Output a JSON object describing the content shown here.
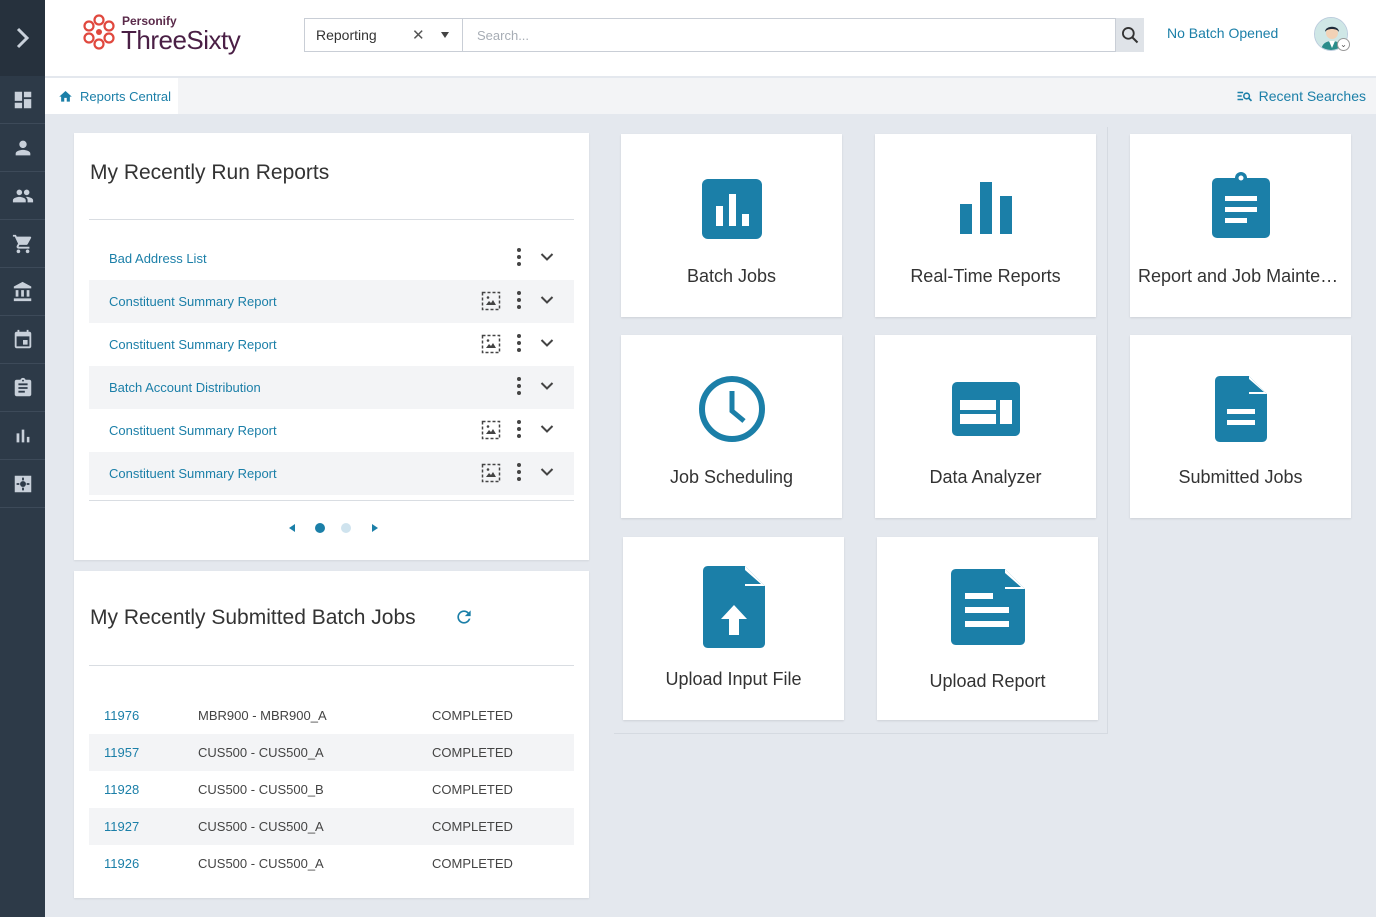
{
  "colors": {
    "accent": "#1b7fa8",
    "rail": "#2d3a48",
    "tile_icon": "#1b7fa8"
  },
  "header": {
    "brand_top": "Personify",
    "brand_main": "ThreeSixty",
    "module_value": "Reporting",
    "search_placeholder": "Search...",
    "batch_status": "No Batch Opened"
  },
  "subnav": {
    "breadcrumb": "Reports Central",
    "recent_searches": "Recent Searches"
  },
  "recent_reports": {
    "title": "My Recently Run Reports",
    "items": [
      {
        "label": "Bad Address List",
        "has_preview": false
      },
      {
        "label": "Constituent Summary Report",
        "has_preview": true
      },
      {
        "label": "Constituent Summary Report",
        "has_preview": true
      },
      {
        "label": "Batch Account Distribution",
        "has_preview": false
      },
      {
        "label": "Constituent Summary Report",
        "has_preview": true
      },
      {
        "label": "Constituent Summary Report",
        "has_preview": true
      }
    ],
    "pager": {
      "current": 1,
      "total": 2
    }
  },
  "batch_jobs": {
    "title": "My Recently Submitted Batch Jobs",
    "rows": [
      {
        "id": "11976",
        "name": "MBR900 - MBR900_A",
        "status": "COMPLETED"
      },
      {
        "id": "11957",
        "name": "CUS500 - CUS500_A",
        "status": "COMPLETED"
      },
      {
        "id": "11928",
        "name": "CUS500 - CUS500_B",
        "status": "COMPLETED"
      },
      {
        "id": "11927",
        "name": "CUS500 - CUS500_A",
        "status": "COMPLETED"
      },
      {
        "id": "11926",
        "name": "CUS500 - CUS500_A",
        "status": "COMPLETED"
      }
    ]
  },
  "tiles": [
    {
      "label": "Batch Jobs",
      "icon": "bar-chart-box-icon"
    },
    {
      "label": "Real-Time Reports",
      "icon": "bar-chart-icon"
    },
    {
      "label": "Report and Job Maintenance",
      "icon": "clipboard-icon"
    },
    {
      "label": "Job Scheduling",
      "icon": "clock-icon"
    },
    {
      "label": "Data Analyzer",
      "icon": "web-layout-icon"
    },
    {
      "label": "Submitted Jobs",
      "icon": "document-icon"
    },
    {
      "label": "Upload Input File",
      "icon": "file-upload-icon"
    },
    {
      "label": "Upload Report",
      "icon": "report-file-icon"
    }
  ],
  "rail_items": [
    "dashboard-icon",
    "person-icon",
    "people-icon",
    "cart-icon",
    "bank-icon",
    "calendar-icon",
    "clipboard-icon",
    "bar-chart-icon",
    "settings-icon"
  ]
}
